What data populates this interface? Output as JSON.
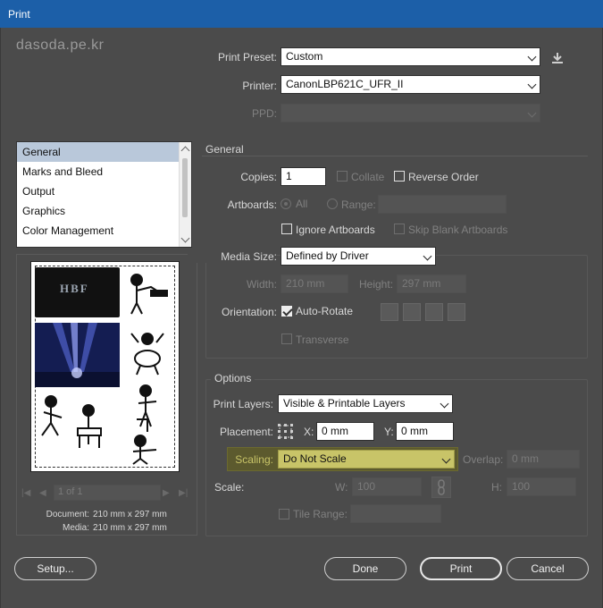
{
  "window": {
    "title": "Print"
  },
  "watermark": "dasoda.pe.kr",
  "top": {
    "print_preset_label": "Print Preset:",
    "print_preset_value": "Custom",
    "printer_label": "Printer:",
    "printer_value": "CanonLBP621C_UFR_II",
    "ppd_label": "PPD:",
    "ppd_value": ""
  },
  "sidebar": {
    "items": [
      {
        "label": "General",
        "selected": true
      },
      {
        "label": "Marks and Bleed"
      },
      {
        "label": "Output"
      },
      {
        "label": "Graphics"
      },
      {
        "label": "Color Management"
      }
    ]
  },
  "preview": {
    "page_label": "1 of 1",
    "document_label": "Document:",
    "document_value": "210 mm x 297 mm",
    "media_label": "Media:",
    "media_value": "210 mm x 297 mm",
    "sticker_text": "HBF"
  },
  "general": {
    "title": "General",
    "copies_label": "Copies:",
    "copies_value": "1",
    "collate_label": "Collate",
    "reverse_order_label": "Reverse Order",
    "artboards_label": "Artboards:",
    "all_label": "All",
    "range_label": "Range:",
    "range_value": "",
    "ignore_artboards_label": "Ignore Artboards",
    "skip_blank_label": "Skip Blank Artboards"
  },
  "media": {
    "media_size_label": "Media Size:",
    "media_size_value": "Defined by Driver",
    "width_label": "Width:",
    "width_value": "210 mm",
    "height_label": "Height:",
    "height_value": "297 mm",
    "orientation_label": "Orientation:",
    "auto_rotate_label": "Auto-Rotate",
    "transverse_label": "Transverse"
  },
  "options": {
    "title": "Options",
    "print_layers_label": "Print Layers:",
    "print_layers_value": "Visible & Printable Layers",
    "placement_label": "Placement:",
    "x_label": "X:",
    "x_value": "0 mm",
    "y_label": "Y:",
    "y_value": "0 mm",
    "scaling_label": "Scaling:",
    "scaling_value": "Do Not Scale",
    "overlap_label": "Overlap:",
    "overlap_value": "0 mm",
    "scale_label": "Scale:",
    "w_label": "W:",
    "w_value": "100",
    "h_label": "H:",
    "h_value": "100",
    "tile_range_label": "Tile Range:",
    "tile_range_value": ""
  },
  "buttons": {
    "setup": "Setup...",
    "done": "Done",
    "print": "Print",
    "cancel": "Cancel"
  },
  "colors": {
    "titlebar": "#1c5fa8",
    "dialog_bg": "#4b4b4b",
    "scaling_highlight": "#c8c468",
    "list_selection": "#b9c8da"
  }
}
